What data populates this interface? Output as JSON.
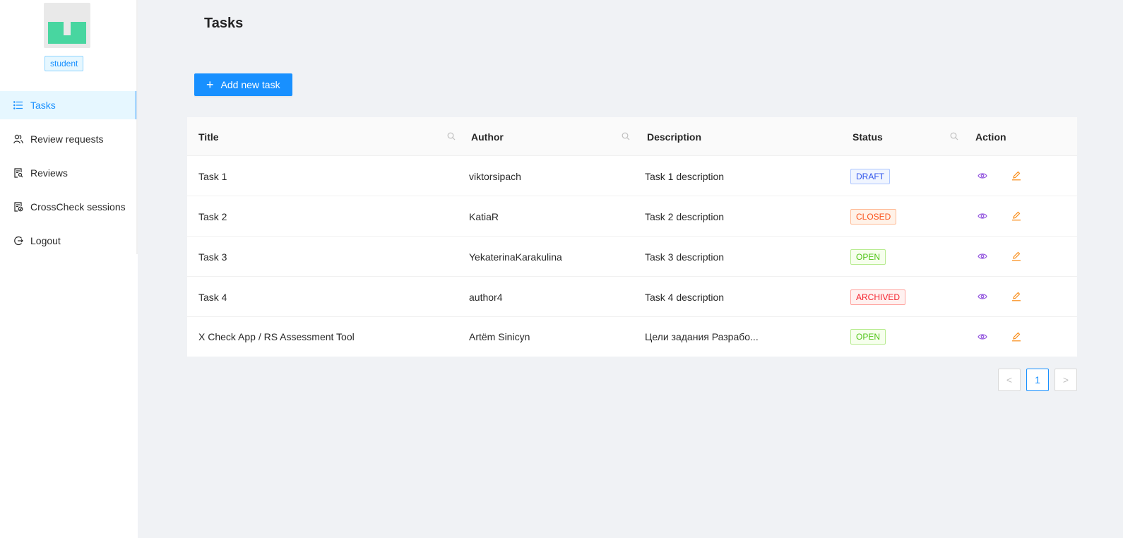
{
  "sidebar": {
    "logo_icon": "app-logo",
    "role": "student",
    "items": [
      {
        "label": "Tasks",
        "icon": "unordered-list-icon",
        "active": true
      },
      {
        "label": "Review requests",
        "icon": "user-group-icon",
        "active": false
      },
      {
        "label": "Reviews",
        "icon": "file-search-icon",
        "active": false
      },
      {
        "label": "CrossCheck sessions",
        "icon": "file-done-icon",
        "active": false
      },
      {
        "label": "Logout",
        "icon": "logout-icon",
        "active": false
      }
    ]
  },
  "main": {
    "title": "Tasks",
    "add_button_label": "Add new task",
    "table": {
      "columns": [
        "Title",
        "Author",
        "Description",
        "Status",
        "Action"
      ],
      "rows": [
        {
          "title": "Task 1",
          "author": "viktorsipach",
          "description": "Task 1 description",
          "status": "DRAFT"
        },
        {
          "title": "Task 2",
          "author": "KatiaR",
          "description": "Task 2 description",
          "status": "CLOSED"
        },
        {
          "title": "Task 3",
          "author": "YekaterinaKarakulina",
          "description": "Task 3 description",
          "status": "OPEN"
        },
        {
          "title": "Task 4",
          "author": "author4",
          "description": "Task 4 description",
          "status": "ARCHIVED"
        },
        {
          "title": "X Check App / RS Assessment Tool",
          "author": "Artëm Sinicyn",
          "description": "Цели задания Разрабо...",
          "status": "OPEN"
        }
      ]
    },
    "pagination": {
      "prev": "<",
      "current": "1",
      "next": ">"
    }
  },
  "colors": {
    "primary": "#1890ff",
    "logo": "#48d6a0",
    "draft": "#2f54eb",
    "closed": "#fa541c",
    "open": "#52c41a",
    "archived": "#f5222d",
    "view_icon": "#9254de",
    "edit_icon": "#fa8c16"
  }
}
